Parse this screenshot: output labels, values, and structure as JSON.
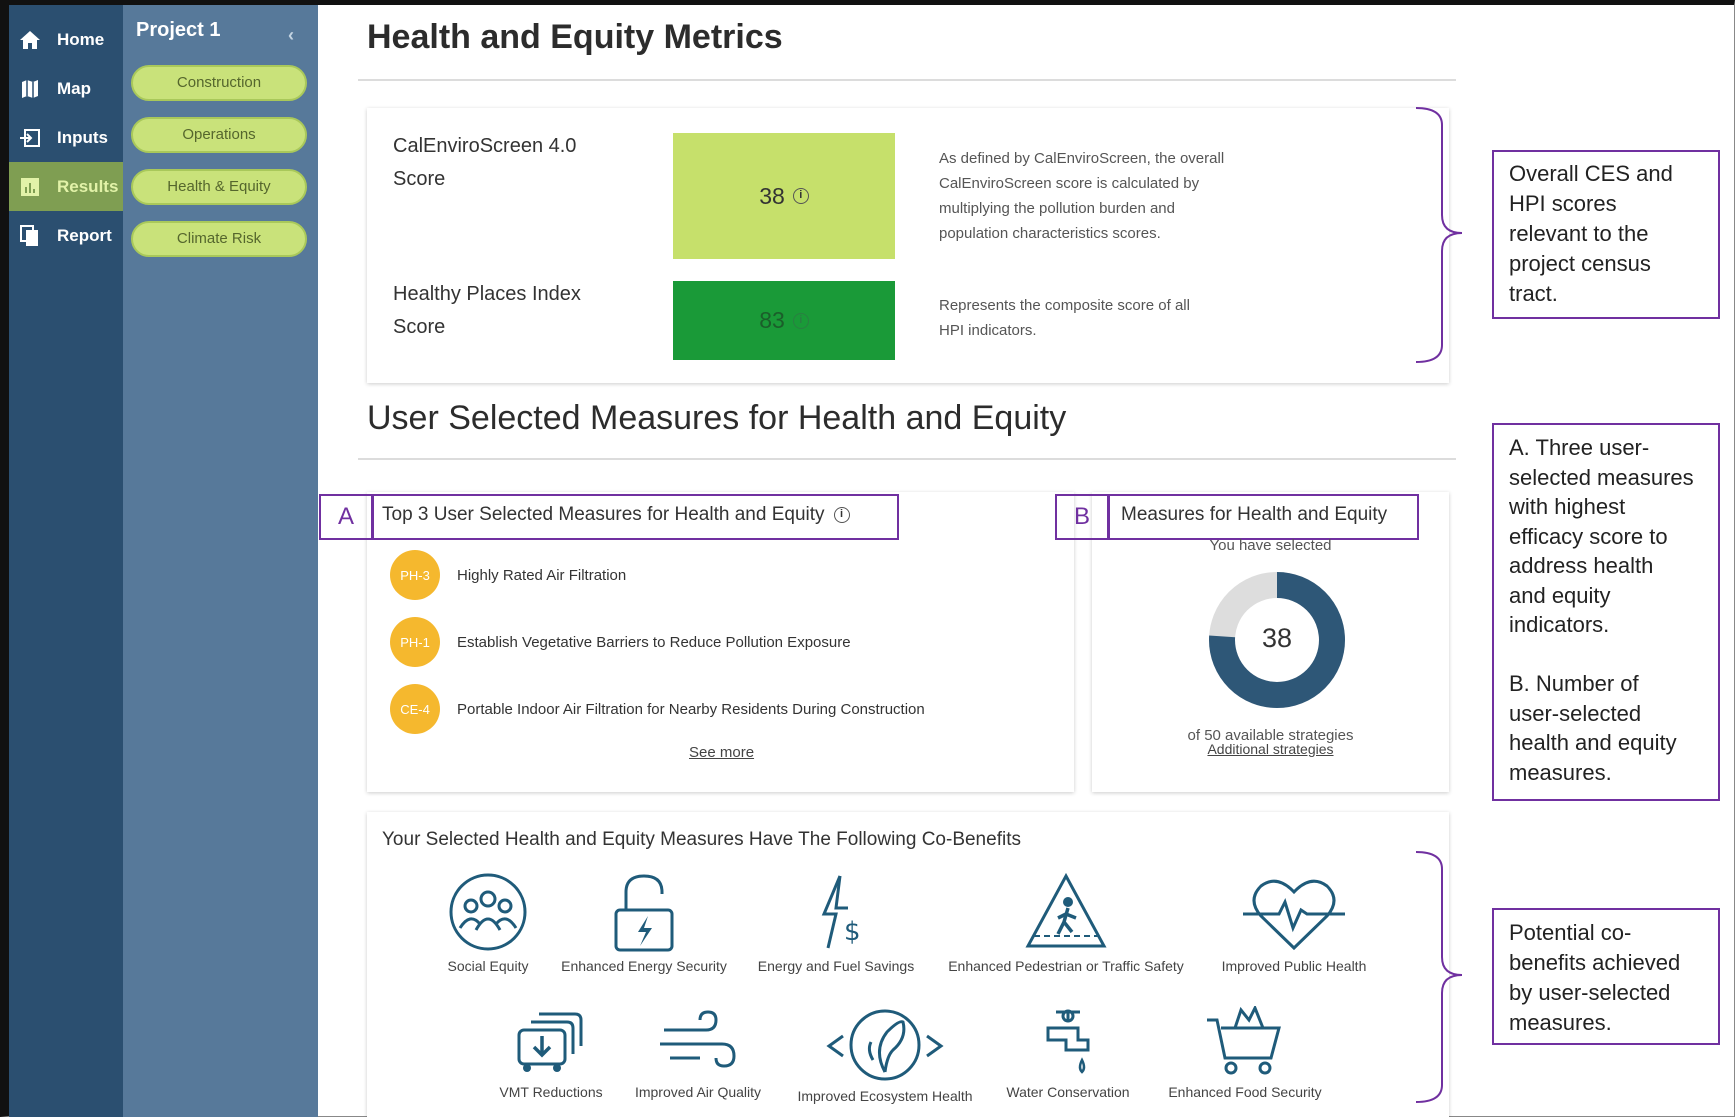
{
  "rail": {
    "items": [
      {
        "label": "Home",
        "icon": "home-icon"
      },
      {
        "label": "Map",
        "icon": "map-icon"
      },
      {
        "label": "Inputs",
        "icon": "inputs-icon"
      },
      {
        "label": "Results",
        "icon": "results-icon",
        "active": true
      },
      {
        "label": "Report",
        "icon": "report-icon"
      }
    ]
  },
  "panel": {
    "title": "Project 1",
    "collapse_glyph": "‹",
    "pills": [
      "Construction",
      "Operations",
      "Health & Equity",
      "Climate Risk"
    ]
  },
  "metrics": {
    "title": "Health and Equity Metrics",
    "ces": {
      "label_line1": "CalEnviroScreen 4.0",
      "label_line2": "Score",
      "score": "38",
      "color": "#c6e06b",
      "desc": [
        "As defined by CalEnviroScreen, the overall",
        "CalEnviroScreen score is calculated by",
        "multiplying the pollution burden and",
        "population characteristics scores."
      ]
    },
    "hpi": {
      "label_line1": "Healthy Places Index",
      "label_line2": "Score",
      "score": "83",
      "color": "#1a9a38",
      "desc": [
        "Represents the composite score of all",
        "HPI indicators."
      ]
    }
  },
  "measures_section": {
    "title": "User Selected Measures for Health and Equity",
    "top3": {
      "letter": "A",
      "title": "Top 3 User Selected Measures for Health and Equity",
      "items": [
        {
          "code": "PH-3",
          "text": "Highly Rated Air Filtration"
        },
        {
          "code": "PH-1",
          "text": "Establish Vegetative Barriers to Reduce Pollution Exposure"
        },
        {
          "code": "CE-4",
          "text": "Portable Indoor Air Filtration for Nearby Residents During Construction"
        }
      ],
      "see_more": "See more"
    },
    "count": {
      "letter": "B",
      "title": "Measures for Health and Equity",
      "subtitle": "You have selected",
      "selected": "38",
      "total_text": "of 50 available strategies",
      "link": "Additional strategies",
      "fraction_selected": 0.76,
      "ring_color": "#2e5777",
      "ring_bg": "#dddddd"
    }
  },
  "cobenefits": {
    "title": "Your Selected Health and Equity Measures Have The Following Co-Benefits",
    "row1": [
      {
        "label": "Social Equity",
        "icon": "social-equity-icon"
      },
      {
        "label": "Enhanced Energy Security",
        "icon": "energy-security-icon"
      },
      {
        "label": "Energy and Fuel Savings",
        "icon": "energy-savings-icon"
      },
      {
        "label": "Enhanced Pedestrian or Traffic Safety",
        "icon": "pedestrian-safety-icon"
      },
      {
        "label": "Improved Public Health",
        "icon": "public-health-icon"
      }
    ],
    "row2": [
      {
        "label": "VMT Reductions",
        "icon": "vmt-icon"
      },
      {
        "label": "Improved Air Quality",
        "icon": "air-quality-icon"
      },
      {
        "label": "Improved Ecosystem Health",
        "icon": "ecosystem-icon"
      },
      {
        "label": "Water Conservation",
        "icon": "water-icon"
      },
      {
        "label": "Enhanced Food Security",
        "icon": "food-security-icon"
      }
    ],
    "icon_color": "#1f5b7a"
  },
  "annotations": {
    "top": [
      "Overall CES and",
      "HPI scores",
      "relevant to the",
      "project census",
      "tract."
    ],
    "middle": [
      "A. Three user-",
      "selected measures",
      "with highest",
      "efficacy score to",
      "address health",
      "and equity",
      "indicators.",
      "",
      "B. Number of",
      "user-selected",
      "health and equity",
      "measures."
    ],
    "bottom": [
      "Potential co-",
      "benefits achieved",
      "by user-selected",
      "measures."
    ],
    "accent": "#7030a0"
  }
}
